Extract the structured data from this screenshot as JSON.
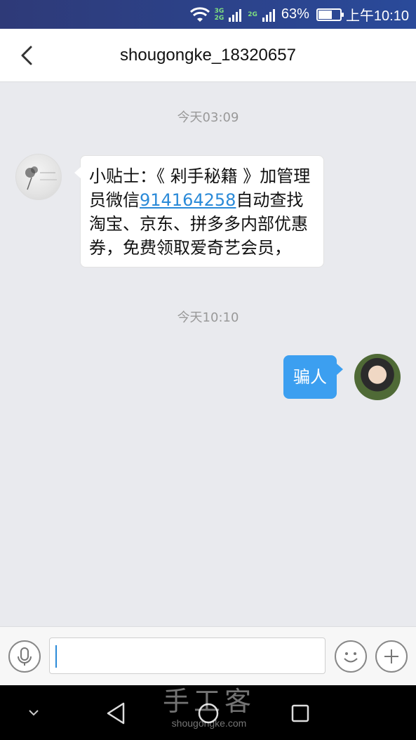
{
  "status_bar": {
    "net_top": "3G",
    "net_bottom": "2G",
    "net_top2": "2G",
    "battery": "63%",
    "battery_level": 0.63,
    "time": "上午10:10"
  },
  "header": {
    "title": "shougongke_18320657"
  },
  "chat": {
    "messages": [
      {
        "timestamp": "今天03:09",
        "side": "left",
        "text_before": "小贴士：《 剁手秘籍 》加管理员微信",
        "link": "914164258",
        "text_after": "自动查找淘宝、京东、拼多多内部优惠券，免费领取爱奇艺会员，"
      },
      {
        "timestamp": "今天10:10",
        "side": "right",
        "text": "骗人"
      }
    ]
  },
  "input": {
    "placeholder": ""
  },
  "watermark": {
    "big": "手工客",
    "small": "shougongke.com"
  },
  "colors": {
    "accent": "#3c9ff0",
    "link": "#2a8ad8",
    "background": "#e9eaee"
  }
}
